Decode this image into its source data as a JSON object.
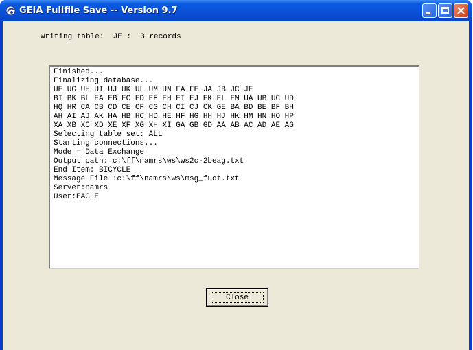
{
  "window": {
    "title": "GEIA Fullfile Save -- Version 9.7",
    "icon": "app-icon"
  },
  "status": {
    "text": "Writing table:  JE :  3 records"
  },
  "log": [
    "Finished...",
    "Finalizing database...",
    "UE UG UH UI UJ UK UL UM UN FA FE JA JB JC JE",
    "BI BK BL EA EB EC ED EF EH EI EJ EK EL EM UA UB UC UD",
    "HQ HR CA CB CD CE CF CG CH CI CJ CK GE BA BD BE BF BH",
    "AH AI AJ AK HA HB HC HD HE HF HG HH HJ HK HM HN HO HP",
    "XA XB XC XD XE XF XG XH XI GA GB GD AA AB AC AD AE AG",
    "Selecting table set: ALL",
    "Starting connections...",
    "Mode = Data Exchange",
    "Output path: c:\\ff\\namrs\\ws\\ws2c-2beag.txt",
    "End Item: BICYCLE",
    "Message File :c:\\ff\\namrs\\ws\\msg_fuot.txt",
    "Server:namrs",
    "User:EAGLE"
  ],
  "buttons": {
    "close_label": "Close"
  },
  "colors": {
    "titlebar": "#0a4fd6",
    "client_bg": "#ece9d8",
    "close_control": "#c8401c"
  }
}
